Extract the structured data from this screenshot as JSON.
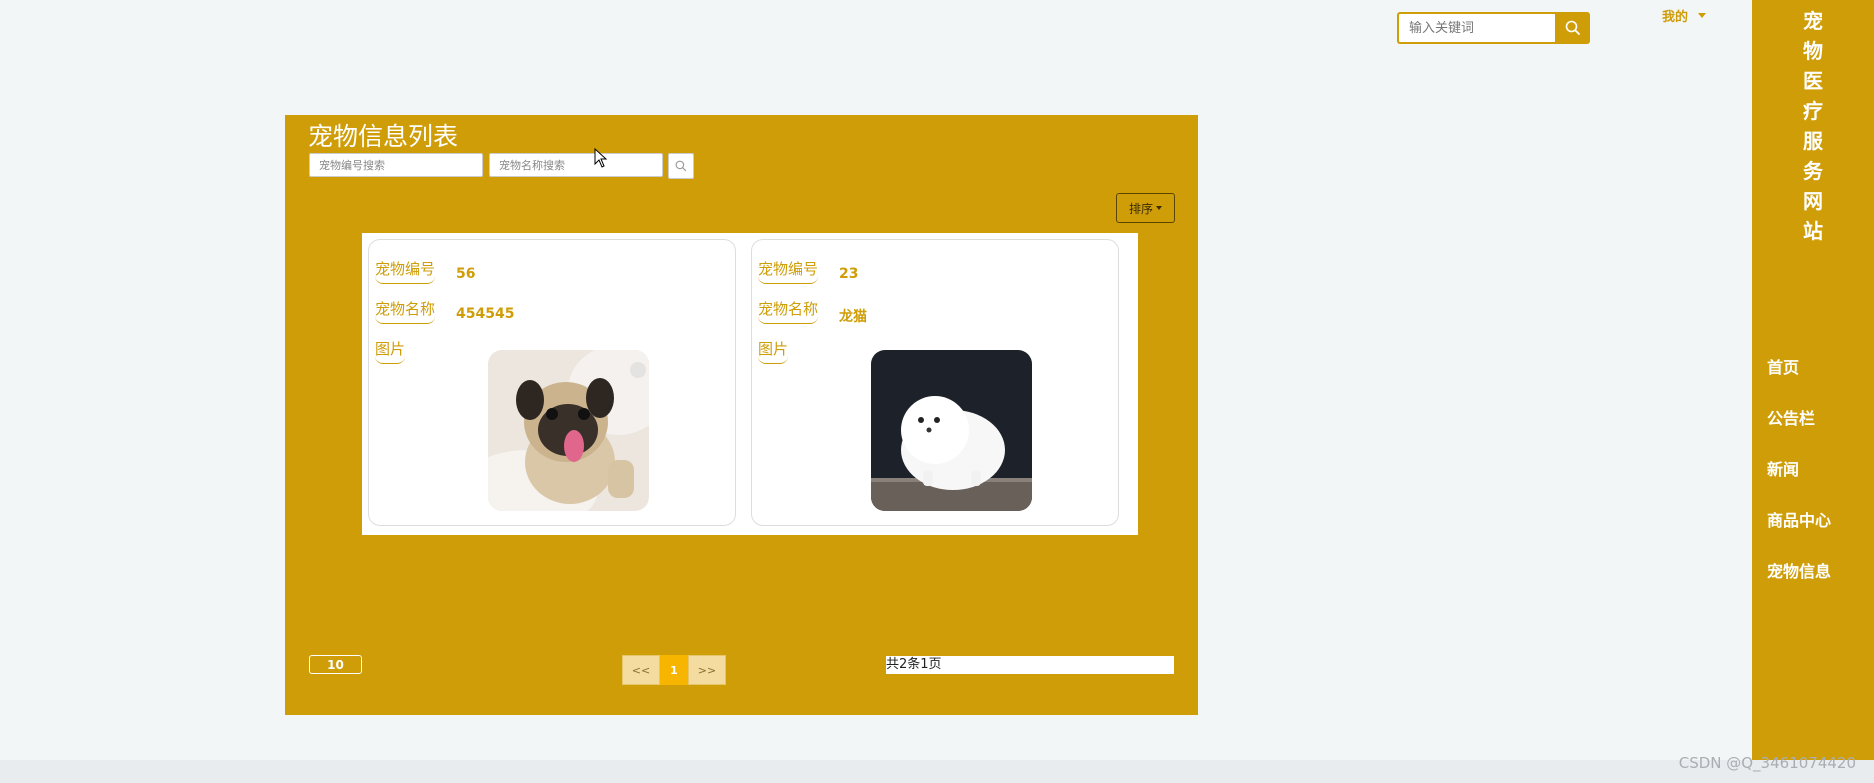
{
  "header": {
    "search_placeholder": "输入关键词",
    "mine_label": "我的",
    "colors": {
      "accent": "#cf9d08"
    }
  },
  "sidebar": {
    "site_title": [
      "宠",
      "物",
      "医",
      "疗",
      "服",
      "务",
      "网",
      "站"
    ],
    "items": [
      {
        "label": "首页"
      },
      {
        "label": "公告栏"
      },
      {
        "label": "新闻"
      },
      {
        "label": "商品中心"
      },
      {
        "label": "宠物信息"
      }
    ]
  },
  "main": {
    "title": "宠物信息列表",
    "filter_number_placeholder": "宠物编号搜索",
    "filter_name_placeholder": "宠物名称搜索",
    "sort_label": "排序",
    "cards": [
      {
        "number_label": "宠物编号",
        "number": "56",
        "name_label": "宠物名称",
        "name": "454545",
        "image_label": "图片",
        "image": "pug-photo"
      },
      {
        "number_label": "宠物编号",
        "number": "23",
        "name_label": "宠物名称",
        "name": "龙猫",
        "image_label": "图片",
        "image": "white-pomeranian-photo"
      }
    ],
    "pagination": {
      "page_size": "10",
      "prev": "<<",
      "current": "1",
      "next": ">>",
      "total_text": "共2条1页"
    }
  },
  "watermark": "CSDN @Q_3461074420"
}
